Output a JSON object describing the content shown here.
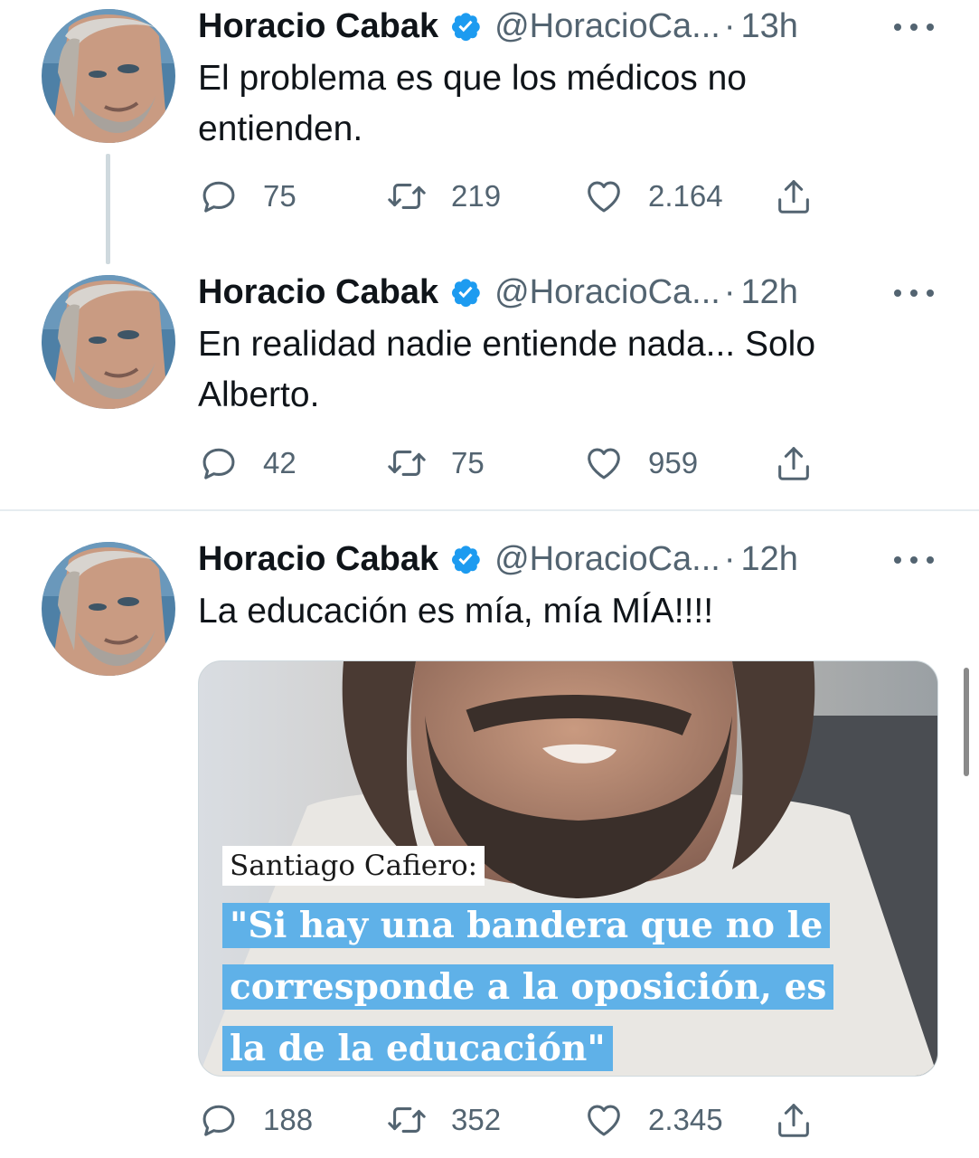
{
  "tweets": [
    {
      "name": "Horacio Cabak",
      "handle": "@HoracioCa...",
      "separator": "·",
      "time": "13h",
      "text": "El problema es que los médicos no entienden.",
      "replies": "75",
      "retweets": "219",
      "likes": "2.164"
    },
    {
      "name": "Horacio Cabak",
      "handle": "@HoracioCa...",
      "separator": "·",
      "time": "12h",
      "text": "En realidad nadie entiende nada... Solo Alberto.",
      "replies": "42",
      "retweets": "75",
      "likes": "959"
    },
    {
      "name": "Horacio Cabak",
      "handle": "@HoracioCa...",
      "separator": "·",
      "time": "12h",
      "text": "La educación es mía, mía MÍA!!!!",
      "replies": "188",
      "retweets": "352",
      "likes": "2.345",
      "media": {
        "caption_label": "Santiago Cafiero:",
        "caption_quote": "\"Si hay una bandera que no le corresponde a la oposición, es la de la educación\""
      }
    }
  ],
  "icons": {
    "verified": "verified-badge-icon",
    "reply": "reply-bubble-icon",
    "retweet": "retweet-arrows-icon",
    "like": "heart-icon",
    "share": "share-upload-icon",
    "more": "more-dots-icon"
  },
  "colors": {
    "verified": "#1d9bf0",
    "icon_gray": "#536471",
    "caption_highlight": "#5fb1e8"
  }
}
